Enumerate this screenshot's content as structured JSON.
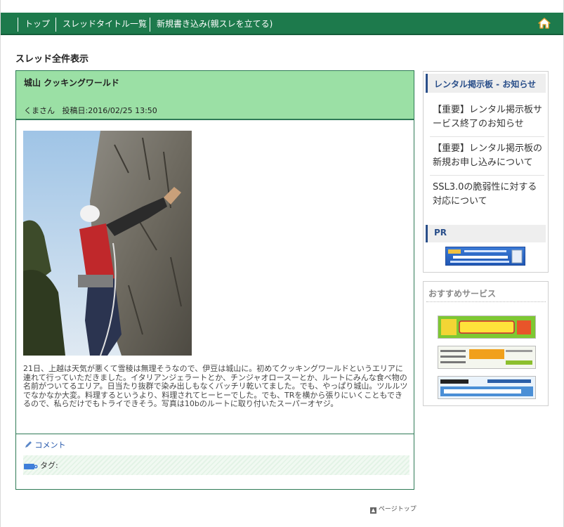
{
  "nav": {
    "items": [
      "トップ",
      "スレッドタイトル一覧",
      "新規書き込み(親スレを立てる)"
    ]
  },
  "page": {
    "title": "スレッド全件表示"
  },
  "thread": {
    "title": "城山 クッキングワールド",
    "author": "くまさん",
    "posted_label": "投稿日:2016/02/25 13:50",
    "body": "21日、上越は天気が悪くて雪稜は無理そうなので、伊豆は城山に。初めてクッキングワールドというエリアに連れて行っていただきました。イタリアンジェラートとか、チンジャオロースーとか、ルートにみんな食べ物の名前がついてるエリア。日当たり抜群で染み出しもなくバッチリ乾いてました。でも、やっぱり城山。ツルルツでなかなか大変。料理するというより、料理されてヒーヒーでした。でも、TRを横から張りにいくこともできるので、私らだけでもトライできそう。写真は10bのルートに取り付いたスーパーオヤジ。",
    "comment_label": "コメント",
    "tag_label": "タグ:"
  },
  "pagetop_label": "ページトップ",
  "sidebar": {
    "notice_title": "レンタル掲示板 - お知らせ",
    "notices": [
      "【重要】レンタル掲示板サービス終了のお知らせ",
      "【重要】レンタル掲示板の新規お申し込みについて",
      "SSL3.0の脆弱性に対する対応について"
    ],
    "pr_title": "PR",
    "recommend_title": "おすすめサービス"
  },
  "colors": {
    "nav_bg": "#1d7a4c",
    "thread_header_bg": "#9be0a5",
    "thread_border": "#2f7a56",
    "notice_title": "#2a4f8a",
    "link": "#2255aa"
  }
}
